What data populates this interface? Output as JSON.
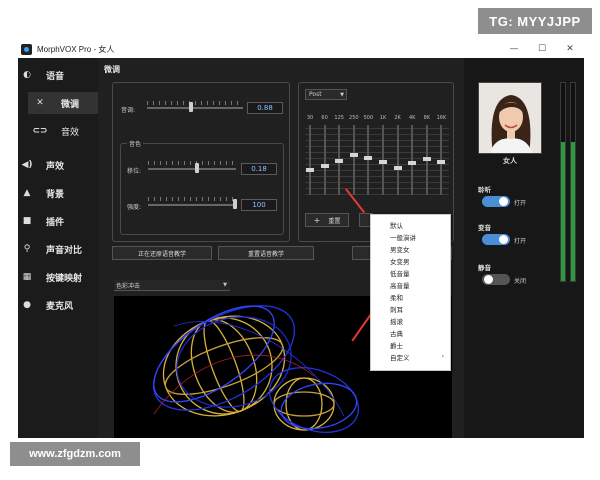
{
  "watermarks": {
    "tg": "TG: MYYJJPP",
    "site": "www.zfgdzm.com"
  },
  "window": {
    "title": "MorphVOX Pro - 女人",
    "minimize": "—",
    "maximize": "☐",
    "close": "✕"
  },
  "sidebar": {
    "items": [
      {
        "label": "语音",
        "icon": "voice-icon"
      },
      {
        "label": "微调",
        "icon": "tools-icon",
        "active": true
      },
      {
        "label": "音效",
        "icon": "effects-icon"
      },
      {
        "label": "声效",
        "icon": "speaker-icon"
      },
      {
        "label": "背景",
        "icon": "background-icon"
      },
      {
        "label": "插件",
        "icon": "plugin-icon"
      },
      {
        "label": "声音对比",
        "icon": "compare-icon"
      },
      {
        "label": "按键映射",
        "icon": "keymap-icon"
      },
      {
        "label": "麦克风",
        "icon": "microphone-icon"
      }
    ]
  },
  "tweak": {
    "section_title": "微调",
    "pitch_label": "音调:",
    "pitch_value": "0.88",
    "timbre_group": "音色",
    "timbre_shift_label": "移位:",
    "timbre_shift_value": "0.18",
    "timbre_strength_label": "强度:",
    "timbre_strength_value": "100"
  },
  "equalizer": {
    "preset": "Post",
    "bands": [
      "30",
      "60",
      "125",
      "250",
      "500",
      "1K",
      "2K",
      "4K",
      "8K",
      "16K"
    ],
    "levels": [
      0.62,
      0.55,
      0.48,
      0.4,
      0.44,
      0.5,
      0.58,
      0.52,
      0.46,
      0.5
    ],
    "reset_button": "重置",
    "plus_icon": "plus-icon"
  },
  "actions": {
    "restore_button": "正在还原语音教学",
    "reset_voice_button": "重置语音教学"
  },
  "visualizer": {
    "select_value": "色彩冲击"
  },
  "context_menu": {
    "items": [
      "默认",
      "一般演讲",
      "男变女",
      "女变男",
      "低音量",
      "高音量",
      "柔和",
      "刺耳",
      "摇滚",
      "古典",
      "爵士",
      "自定义"
    ],
    "submenu_arrow": "›"
  },
  "right_panel": {
    "voice_name": "女人",
    "listen_label": "聆听",
    "listen_state": "打开",
    "morph_label": "变音",
    "morph_state": "打开",
    "mute_label": "静音",
    "mute_state": "关闭",
    "vu_levels": [
      0.7,
      0.7
    ],
    "toggle_on_color": "#4a8fd6",
    "vu_color": "#2a9a3c"
  },
  "annotation": {
    "arrow_color": "#e53935"
  }
}
